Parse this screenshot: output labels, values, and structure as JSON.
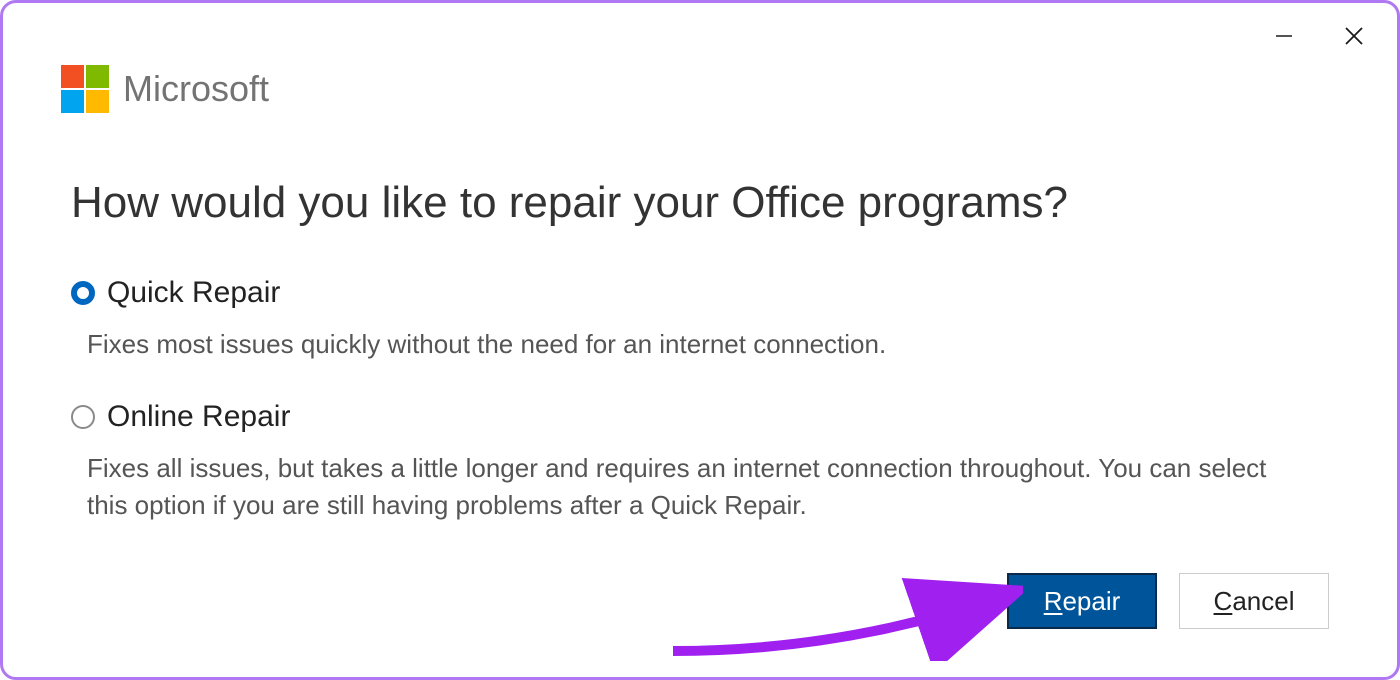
{
  "brand": {
    "name": "Microsoft",
    "logo_colors": {
      "tl": "#f25022",
      "tr": "#7fba00",
      "bl": "#00a4ef",
      "br": "#ffb900"
    }
  },
  "heading": "How would you like to repair your Office programs?",
  "options": {
    "quick": {
      "label": "Quick Repair",
      "desc": "Fixes most issues quickly without the need for an internet connection.",
      "selected": true
    },
    "online": {
      "label": "Online Repair",
      "desc": "Fixes all issues, but takes a little longer and requires an internet connection throughout. You can select this option if you are still having problems after a Quick Repair.",
      "selected": false
    }
  },
  "buttons": {
    "repair_prefix": "R",
    "repair_rest": "epair",
    "cancel_prefix": "C",
    "cancel_rest": "ancel"
  },
  "colors": {
    "accent": "#0067c0",
    "primary_btn": "#005499",
    "arrow": "#a020f0"
  }
}
